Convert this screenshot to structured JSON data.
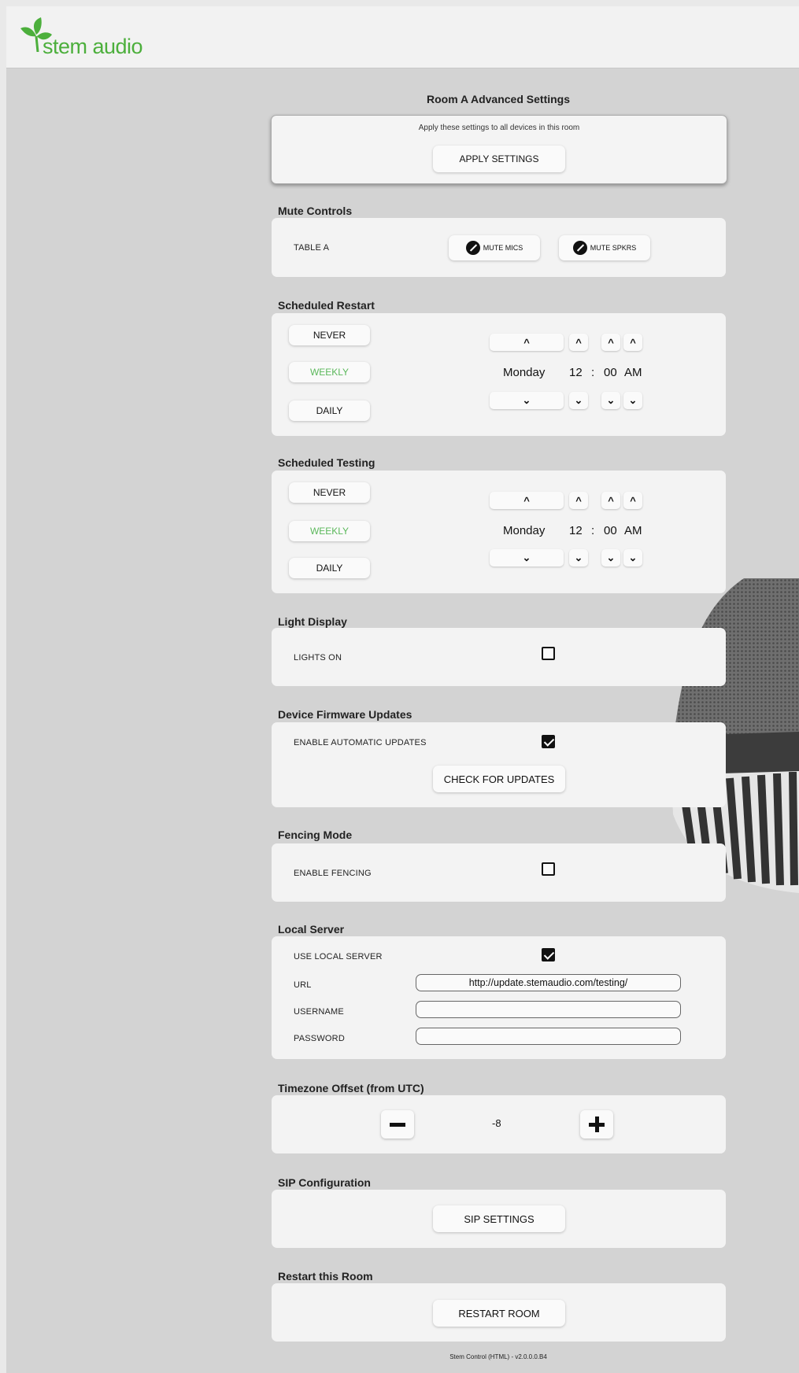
{
  "brand": {
    "logo_text": "stem audio",
    "logo_color": "#4caf3c"
  },
  "page": {
    "title": "Room A Advanced Settings"
  },
  "apply": {
    "text": "Apply these settings to all devices in this room",
    "button": "APPLY SETTINGS"
  },
  "mute_controls": {
    "heading": "Mute Controls",
    "table_label": "TABLE A",
    "mute_mics": "MUTE MICS",
    "mute_spkrs": "MUTE SPKRS"
  },
  "scheduled_restart": {
    "heading": "Scheduled Restart",
    "options": [
      "NEVER",
      "WEEKLY",
      "DAILY"
    ],
    "selected": "WEEKLY",
    "day": "Monday",
    "hour": "12",
    "separator": ":",
    "minute": "00",
    "ampm": "AM"
  },
  "scheduled_testing": {
    "heading": "Scheduled Testing",
    "options": [
      "NEVER",
      "WEEKLY",
      "DAILY"
    ],
    "selected": "WEEKLY",
    "day": "Monday",
    "hour": "12",
    "separator": ":",
    "minute": "00",
    "ampm": "AM"
  },
  "light_display": {
    "heading": "Light Display",
    "label": "LIGHTS ON",
    "checked": false
  },
  "firmware": {
    "heading": "Device Firmware Updates",
    "label": "ENABLE AUTOMATIC UPDATES",
    "checked": true,
    "button": "CHECK FOR UPDATES"
  },
  "fencing": {
    "heading": "Fencing Mode",
    "label": "ENABLE FENCING",
    "checked": false
  },
  "local_server": {
    "heading": "Local Server",
    "use_label": "USE LOCAL SERVER",
    "use_checked": true,
    "url_label": "URL",
    "url_value": "http://update.stemaudio.com/testing/",
    "username_label": "USERNAME",
    "username_value": "",
    "password_label": "PASSWORD",
    "password_value": ""
  },
  "timezone": {
    "heading": "Timezone Offset (from UTC)",
    "value": "-8"
  },
  "sip": {
    "heading": "SIP Configuration",
    "button": "SIP SETTINGS"
  },
  "restart_room": {
    "heading": "Restart this Room",
    "button": "RESTART ROOM"
  },
  "footer": {
    "text": "Stem Control (HTML) - v2.0.0.0.B4"
  },
  "colors": {
    "accent_green": "#5bb85b",
    "background": "#d3d3d3",
    "card": "#f3f3f3"
  },
  "icons": [
    "leaf-logo-icon",
    "mic-muted-icon",
    "speaker-muted-icon",
    "chevron-up-icon",
    "chevron-down-icon",
    "checkbox-icon",
    "minus-icon",
    "plus-icon"
  ]
}
